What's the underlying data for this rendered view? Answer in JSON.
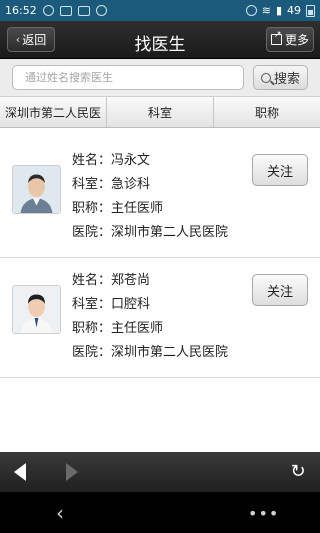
{
  "status_bar": {
    "time": "16:52",
    "battery": "49"
  },
  "header": {
    "back_label": "返回",
    "title": "找医生",
    "more_label": "更多"
  },
  "search": {
    "placeholder": "通过姓名搜索医生",
    "button_label": "搜索"
  },
  "filters": [
    "深圳市第二人民医",
    "科室",
    "职称"
  ],
  "doctors": [
    {
      "name_line": "姓名：冯永文",
      "dept_line": "科室：急诊科",
      "title_line": "职称：主任医师",
      "hospital_line": "医院：深圳市第二人民医院",
      "follow_label": "关注"
    },
    {
      "name_line": "姓名：郑苍尚",
      "dept_line": "科室：口腔科",
      "title_line": "职称：主任医师",
      "hospital_line": "医院：深圳市第二人民医院",
      "follow_label": "关注"
    }
  ],
  "icons": {
    "status_left": [
      "qq-icon",
      "chat-icon",
      "image-icon",
      "message-icon",
      "check-icon"
    ],
    "status_right": [
      "alarm-icon",
      "wifi-icon",
      "signal-icon",
      "battery-icon"
    ],
    "nav": [
      "back-arrow-icon",
      "forward-arrow-icon",
      "refresh-icon"
    ]
  }
}
